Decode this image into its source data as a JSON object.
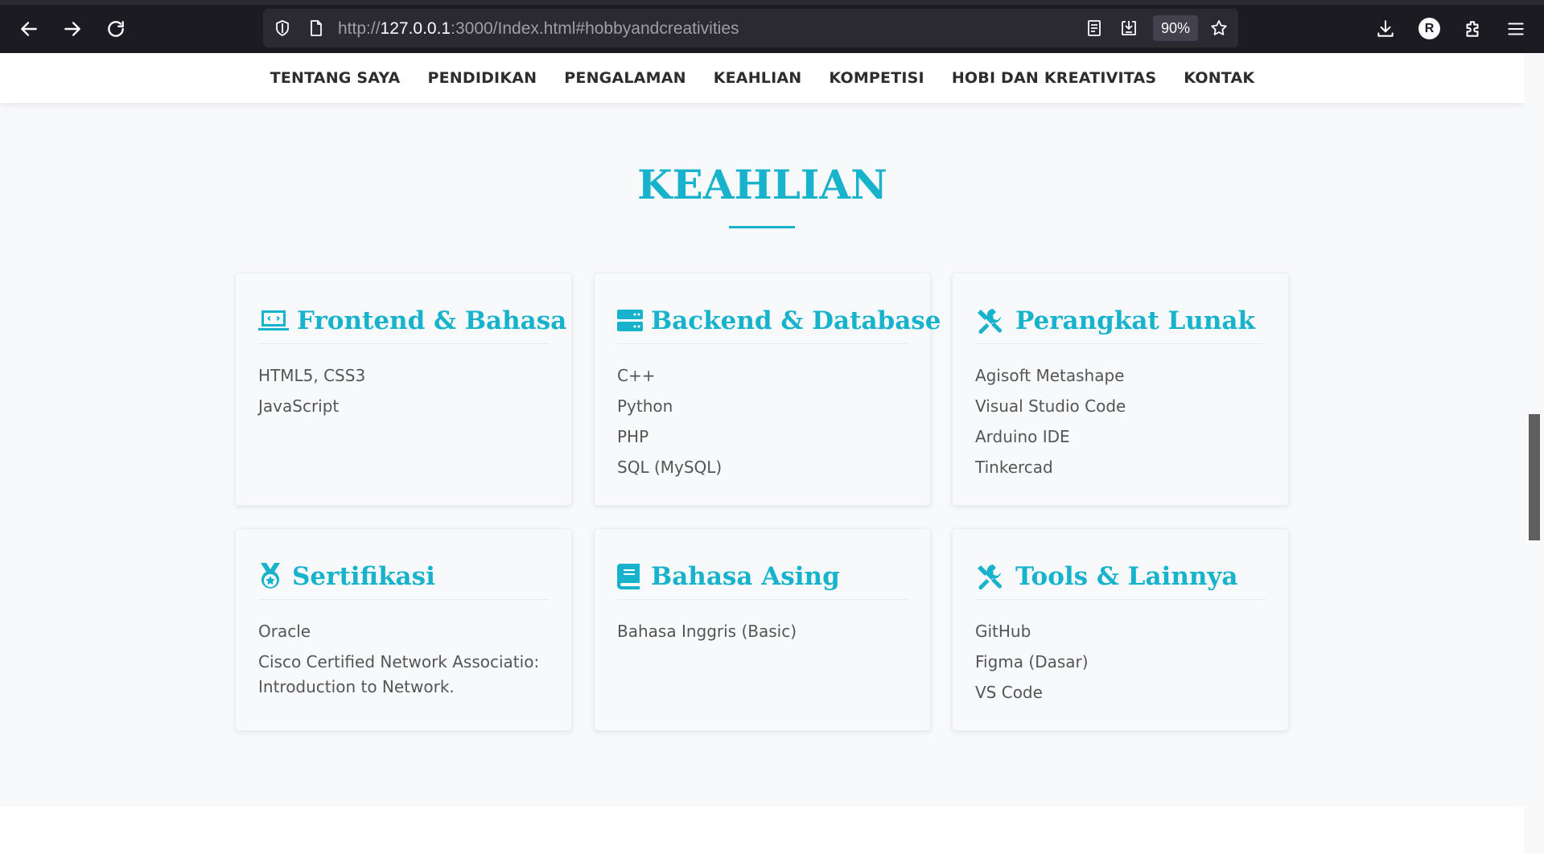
{
  "browser": {
    "url_prefix": "http://",
    "url_host": "127.0.0.1",
    "url_rest": ":3000/Index.html#hobbyandcreativities",
    "zoom": "90%",
    "profile_initial": "R"
  },
  "nav": {
    "items": [
      {
        "label": "TENTANG SAYA"
      },
      {
        "label": "PENDIDIKAN"
      },
      {
        "label": "PENGALAMAN"
      },
      {
        "label": "KEAHLIAN"
      },
      {
        "label": "KOMPETISI"
      },
      {
        "label": "HOBI DAN KREATIVITAS"
      },
      {
        "label": "KONTAK"
      }
    ]
  },
  "section": {
    "title": "KEAHLIAN",
    "accent_color": "#17b3cc"
  },
  "cards": [
    {
      "title": "Frontend & Bahasa",
      "icon": "laptop-code-icon",
      "items": [
        "HTML5, CSS3",
        "JavaScript"
      ]
    },
    {
      "title": "Backend & Database",
      "icon": "server-icon",
      "items": [
        "C++",
        "Python",
        "PHP",
        "SQL (MySQL)"
      ]
    },
    {
      "title": "Perangkat Lunak",
      "icon": "tools-icon",
      "items": [
        "Agisoft Metashape",
        "Visual Studio Code",
        "Arduino IDE",
        "Tinkercad"
      ]
    },
    {
      "title": "Sertifikasi",
      "icon": "medal-icon",
      "items": [
        "Oracle",
        "Cisco Certified Network Associatio: Introduction to Network."
      ]
    },
    {
      "title": "Bahasa Asing",
      "icon": "book-icon",
      "items": [
        "Bahasa Inggris (Basic)"
      ]
    },
    {
      "title": "Tools & Lainnya",
      "icon": "tools-icon",
      "items": [
        "GitHub",
        "Figma (Dasar)",
        "VS Code"
      ]
    }
  ]
}
